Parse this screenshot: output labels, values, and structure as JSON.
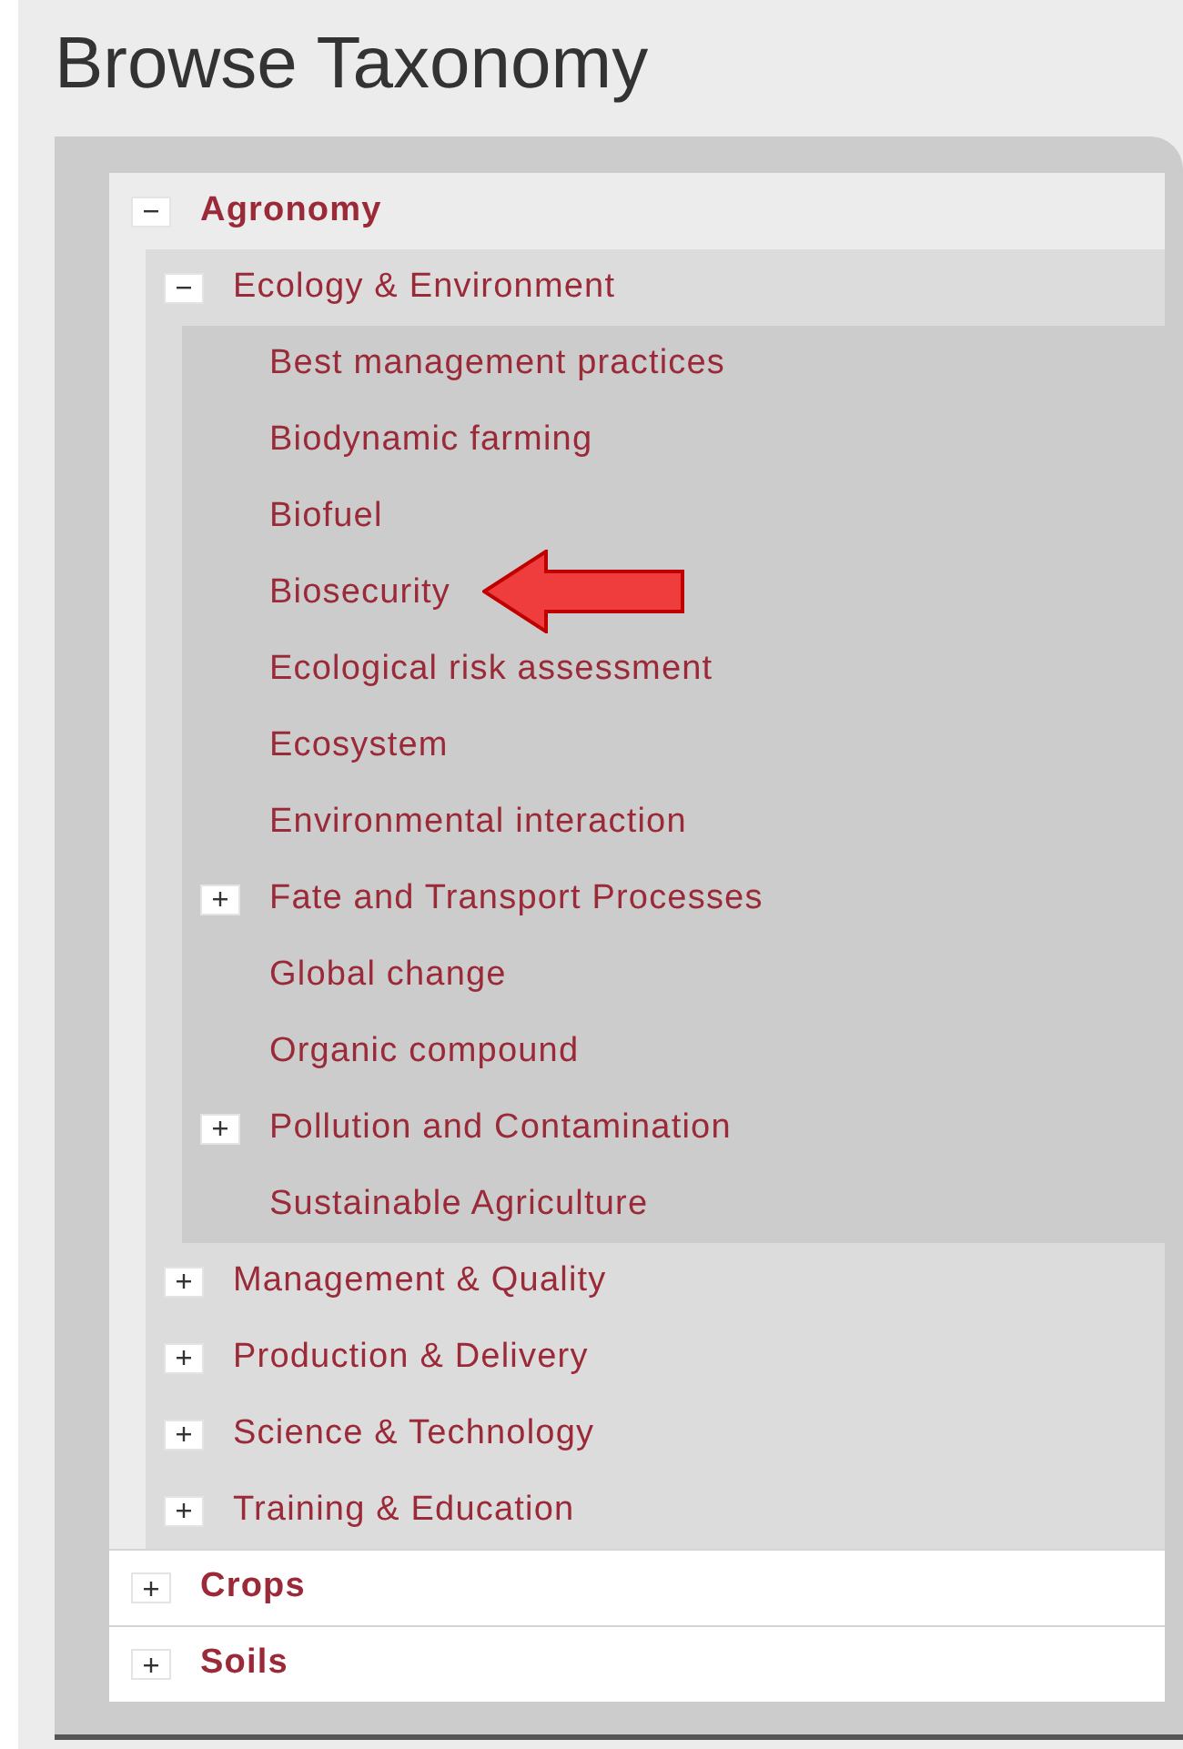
{
  "title": "Browse Taxonomy",
  "tree": [
    {
      "label": "Agronomy",
      "kind": "node",
      "expanded": true,
      "children": [
        {
          "label": "Ecology & Environment",
          "kind": "node",
          "expanded": true,
          "children": [
            {
              "label": "Best management practices",
              "kind": "leaf"
            },
            {
              "label": "Biodynamic farming",
              "kind": "leaf"
            },
            {
              "label": "Biofuel",
              "kind": "leaf"
            },
            {
              "label": "Biosecurity",
              "kind": "leaf"
            },
            {
              "label": "Ecological risk assessment",
              "kind": "leaf"
            },
            {
              "label": "Ecosystem",
              "kind": "leaf"
            },
            {
              "label": "Environmental interaction",
              "kind": "leaf"
            },
            {
              "label": "Fate and Transport Processes",
              "kind": "node",
              "expanded": false
            },
            {
              "label": "Global change",
              "kind": "leaf"
            },
            {
              "label": "Organic compound",
              "kind": "leaf"
            },
            {
              "label": "Pollution and Contamination",
              "kind": "node",
              "expanded": false
            },
            {
              "label": "Sustainable Agriculture",
              "kind": "leaf"
            }
          ]
        },
        {
          "label": "Management & Quality",
          "kind": "node",
          "expanded": false
        },
        {
          "label": "Production & Delivery",
          "kind": "node",
          "expanded": false
        },
        {
          "label": "Science & Technology",
          "kind": "node",
          "expanded": false
        },
        {
          "label": "Training & Education",
          "kind": "node",
          "expanded": false
        }
      ]
    },
    {
      "label": "Crops",
      "kind": "node",
      "expanded": false
    },
    {
      "label": "Soils",
      "kind": "node",
      "expanded": false
    }
  ]
}
